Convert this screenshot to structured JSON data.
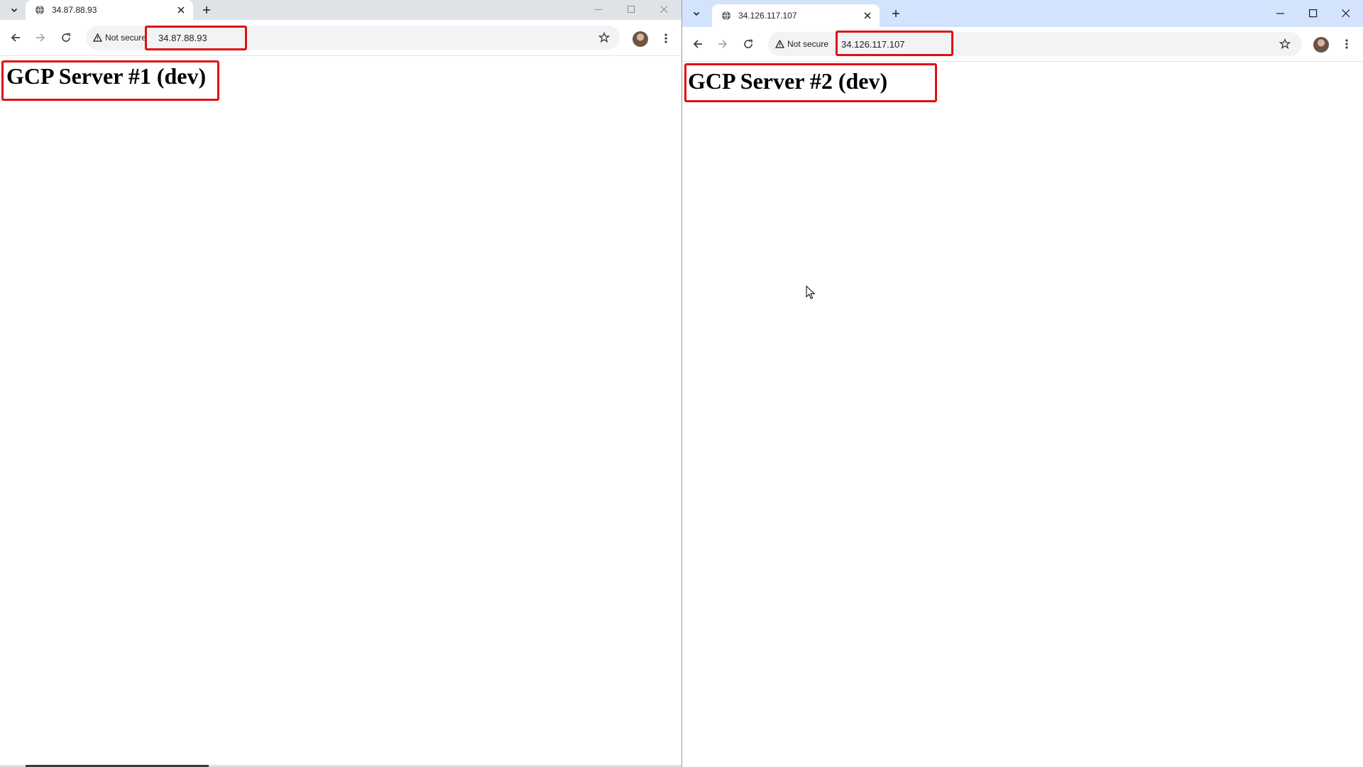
{
  "windows": [
    {
      "tab_title": "34.87.88.93",
      "security_label": "Not secure",
      "url": "34.87.88.93",
      "heading": "GCP Server #1 (dev)"
    },
    {
      "tab_title": "34.126.117.107",
      "security_label": "Not secure",
      "url": "34.126.117.107",
      "heading": "GCP Server #2 (dev)"
    }
  ],
  "icons": {
    "tab_search": "chevron-down-icon",
    "favicon": "globe-icon",
    "close_tab": "close-icon",
    "new_tab": "plus-icon",
    "back": "arrow-left-icon",
    "forward": "arrow-right-icon",
    "reload": "reload-icon",
    "security": "warning-triangle-icon",
    "bookmark": "star-icon",
    "profile": "avatar",
    "menu": "kebab-menu-icon",
    "minimize": "minimize-icon",
    "maximize": "maximize-icon",
    "close_window": "close-icon"
  },
  "colors": {
    "highlight": "#e01010",
    "inactive_tabstrip": "#dfe3e8",
    "active_tabstrip": "#d3e3fd"
  }
}
